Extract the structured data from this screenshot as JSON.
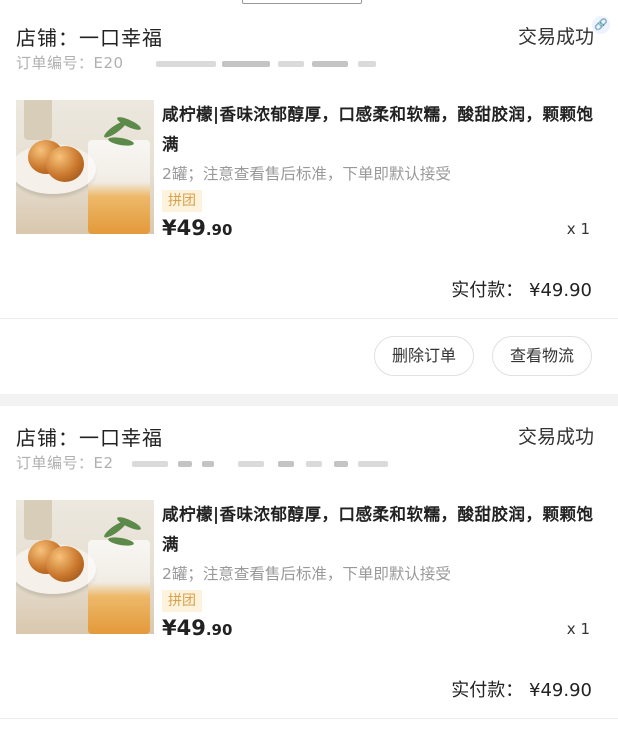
{
  "orders": [
    {
      "shop_label": "店铺：一口幸福",
      "status": "交易成功",
      "order_no_label": "订单编号：E20",
      "product_title": "咸柠檬|香味浓郁醇厚，口感柔和软糯，酸甜胶润，颗颗饱满",
      "spec": "2罐；注意查看售后标准，下单即默认接受",
      "tag": "拼团",
      "currency": "¥",
      "price_int": "49",
      "price_dec": ".90",
      "qty": "x 1",
      "paid_label": "实付款：",
      "paid_amount": "¥49.90",
      "actions": {
        "delete": "删除订单",
        "logistics": "查看物流"
      }
    },
    {
      "shop_label": "店铺：一口幸福",
      "status": "交易成功",
      "order_no_label": "订单编号：E2",
      "product_title": "咸柠檬|香味浓郁醇厚，口感柔和软糯，酸甜胶润，颗颗饱满",
      "spec": "2罐；注意查看售后标准，下单即默认接受",
      "tag": "拼团",
      "currency": "¥",
      "price_int": "49",
      "price_dec": ".90",
      "qty": "x 1",
      "paid_label": "实付款：",
      "paid_amount": "¥49.90"
    }
  ],
  "icons": {
    "link": "link-icon",
    "product": "product-thumbnail"
  },
  "colors": {
    "tag_bg": "#fdf3dc",
    "tag_text": "#d8a24a",
    "muted": "#999999"
  }
}
